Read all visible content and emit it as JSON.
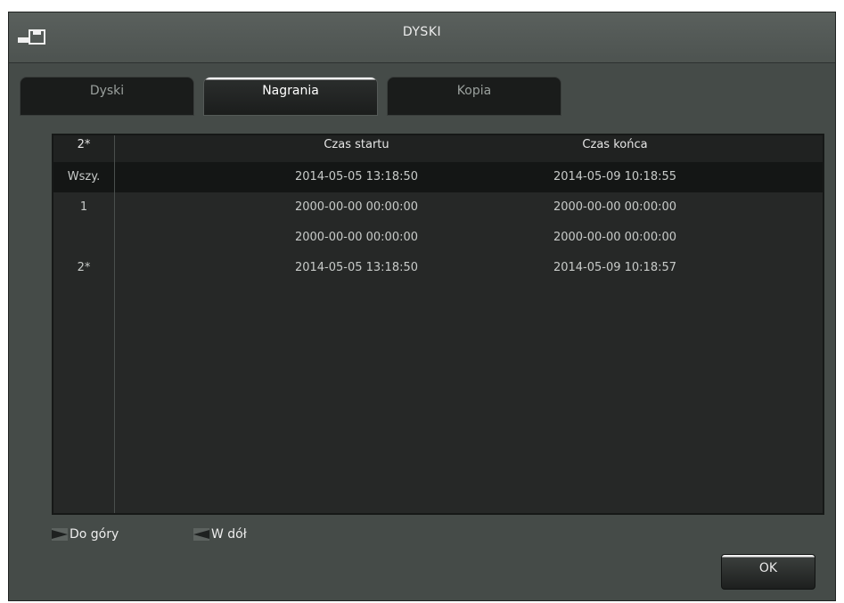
{
  "window": {
    "title": "DYSKI",
    "icon": "disk-save-icon"
  },
  "tabs": [
    {
      "label": "Dyski",
      "active": false
    },
    {
      "label": "Nagrania",
      "active": true
    },
    {
      "label": "Kopia",
      "active": false
    }
  ],
  "table": {
    "headers": {
      "id": "2*",
      "start": "Czas startu",
      "end": "Czas końca"
    },
    "rows": [
      {
        "id": "Wszy.",
        "start": "2014-05-05 13:18:50",
        "end": "2014-05-09 10:18:55",
        "selected": true
      },
      {
        "id": "1",
        "start": "2000-00-00 00:00:00",
        "end": "2000-00-00 00:00:00",
        "selected": false
      },
      {
        "id": "",
        "start": "2000-00-00 00:00:00",
        "end": "2000-00-00 00:00:00",
        "selected": false
      },
      {
        "id": "2*",
        "start": "2014-05-05 13:18:50",
        "end": "2014-05-09 10:18:57",
        "selected": false
      }
    ]
  },
  "nav": {
    "up_label": "Do góry",
    "down_label": "W dół"
  },
  "ok_label": "OK"
}
